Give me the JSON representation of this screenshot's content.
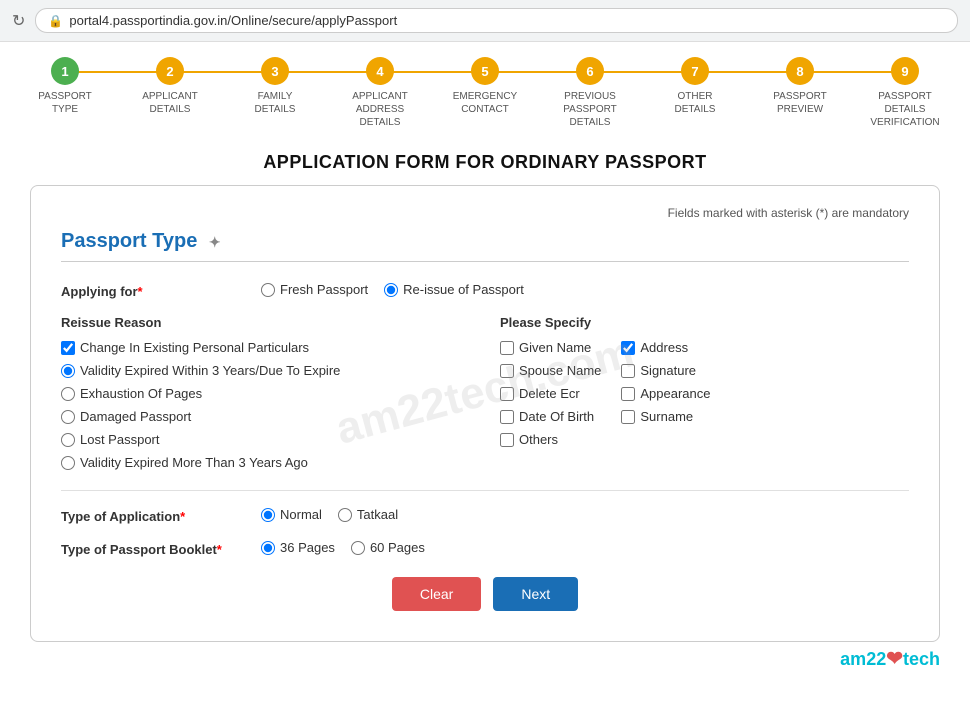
{
  "browser": {
    "url": "portal4.passportindia.gov.in/Online/secure/applyPassport",
    "refresh_icon": "↻",
    "lock_icon": "🔒"
  },
  "steps": [
    {
      "number": "1",
      "label": "PASSPORT TYPE",
      "status": "active"
    },
    {
      "number": "2",
      "label": "APPLICANT DETAILS",
      "status": "pending"
    },
    {
      "number": "3",
      "label": "FAMILY DETAILS",
      "status": "pending"
    },
    {
      "number": "4",
      "label": "APPLICANT ADDRESS DETAILS",
      "status": "pending"
    },
    {
      "number": "5",
      "label": "EMERGENCY CONTACT",
      "status": "pending"
    },
    {
      "number": "6",
      "label": "PREVIOUS PASSPORT DETAILS",
      "status": "pending"
    },
    {
      "number": "7",
      "label": "OTHER DETAILS",
      "status": "pending"
    },
    {
      "number": "8",
      "label": "PASSPORT PREVIEW",
      "status": "pending"
    },
    {
      "number": "9",
      "label": "PASSPORT DETAILS VERIFICATION",
      "status": "pending"
    }
  ],
  "page_title": "APPLICATION FORM FOR ORDINARY PASSPORT",
  "mandatory_note": "Fields marked with asterisk (*) are mandatory",
  "section_title": "Passport Type",
  "applying_for": {
    "label": "Applying for",
    "required": true,
    "options": [
      {
        "value": "fresh",
        "label": "Fresh Passport"
      },
      {
        "value": "reissue",
        "label": "Re-issue of Passport",
        "checked": true
      }
    ]
  },
  "reissue_reason": {
    "heading": "Reissue Reason",
    "options": [
      {
        "value": "change",
        "label": "Change In Existing Personal Particulars",
        "type": "checkbox",
        "checked": true
      },
      {
        "value": "validity3",
        "label": "Validity Expired Within 3 Years/Due To Expire",
        "type": "radio",
        "checked": true
      },
      {
        "value": "exhaustion",
        "label": "Exhaustion Of Pages",
        "type": "radio",
        "checked": false
      },
      {
        "value": "damaged",
        "label": "Damaged Passport",
        "type": "radio",
        "checked": false
      },
      {
        "value": "lost",
        "label": "Lost Passport",
        "type": "radio",
        "checked": false
      },
      {
        "value": "validity3plus",
        "label": "Validity Expired More Than 3 Years Ago",
        "type": "radio",
        "checked": false
      }
    ]
  },
  "please_specify": {
    "heading": "Please Specify",
    "col1": [
      {
        "value": "given_name",
        "label": "Given Name",
        "checked": false
      },
      {
        "value": "spouse_name",
        "label": "Spouse Name",
        "checked": false
      },
      {
        "value": "delete_ecr",
        "label": "Delete Ecr",
        "checked": false
      },
      {
        "value": "date_of_birth",
        "label": "Date Of Birth",
        "checked": false
      },
      {
        "value": "others",
        "label": "Others",
        "checked": false
      }
    ],
    "col2": [
      {
        "value": "address",
        "label": "Address",
        "checked": true
      },
      {
        "value": "signature",
        "label": "Signature",
        "checked": false
      },
      {
        "value": "appearance",
        "label": "Appearance",
        "checked": false
      },
      {
        "value": "surname",
        "label": "Surname",
        "checked": false
      }
    ]
  },
  "type_of_application": {
    "label": "Type of Application",
    "required": true,
    "options": [
      {
        "value": "normal",
        "label": "Normal",
        "checked": true
      },
      {
        "value": "tatkaal",
        "label": "Tatkaal",
        "checked": false
      }
    ]
  },
  "type_of_booklet": {
    "label": "Type of Passport Booklet",
    "required": true,
    "options": [
      {
        "value": "36",
        "label": "36 Pages",
        "checked": true
      },
      {
        "value": "60",
        "label": "60 Pages",
        "checked": false
      }
    ]
  },
  "buttons": {
    "clear": "Clear",
    "next": "Next"
  },
  "watermark": "am22tech.com",
  "branding": {
    "text": "am22tech",
    "heart": "❤"
  }
}
